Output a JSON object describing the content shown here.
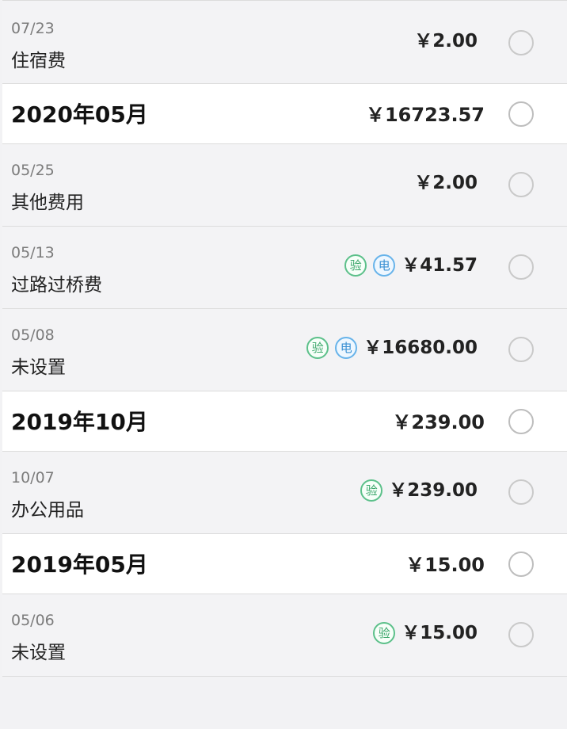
{
  "groups": [
    {
      "type": "item",
      "date": "07/23",
      "category": "住宿费",
      "amount": "￥2.00",
      "badges": []
    },
    {
      "type": "month",
      "label": "2020年05月",
      "amount": "￥16723.57"
    },
    {
      "type": "item",
      "date": "05/25",
      "category": "其他费用",
      "amount": "￥2.00",
      "badges": []
    },
    {
      "type": "item",
      "date": "05/13",
      "category": "过路过桥费",
      "amount": "￥41.57",
      "badges": [
        {
          "kind": "check",
          "text": "验",
          "icon": "verified-icon"
        },
        {
          "kind": "elec",
          "text": "电",
          "icon": "electronic-invoice-icon"
        }
      ]
    },
    {
      "type": "item",
      "date": "05/08",
      "category": "未设置",
      "amount": "￥16680.00",
      "badges": [
        {
          "kind": "check",
          "text": "验",
          "icon": "verified-icon"
        },
        {
          "kind": "elec",
          "text": "电",
          "icon": "electronic-invoice-icon"
        }
      ]
    },
    {
      "type": "month",
      "label": "2019年10月",
      "amount": "￥239.00"
    },
    {
      "type": "item",
      "date": "10/07",
      "category": "办公用品",
      "amount": "￥239.00",
      "badges": [
        {
          "kind": "check",
          "text": "验",
          "icon": "verified-icon"
        }
      ]
    },
    {
      "type": "month",
      "label": "2019年05月",
      "amount": "￥15.00"
    },
    {
      "type": "item",
      "date": "05/06",
      "category": "未设置",
      "amount": "￥15.00",
      "badges": [
        {
          "kind": "check",
          "text": "验",
          "icon": "verified-icon"
        }
      ]
    }
  ],
  "colors": {
    "background": "#f2f2f4",
    "monthBackground": "#ffffff",
    "checkBadge": "#3ea86d",
    "electronicBadge": "#3a90d3",
    "radioBorder": "#c9c9c9"
  }
}
